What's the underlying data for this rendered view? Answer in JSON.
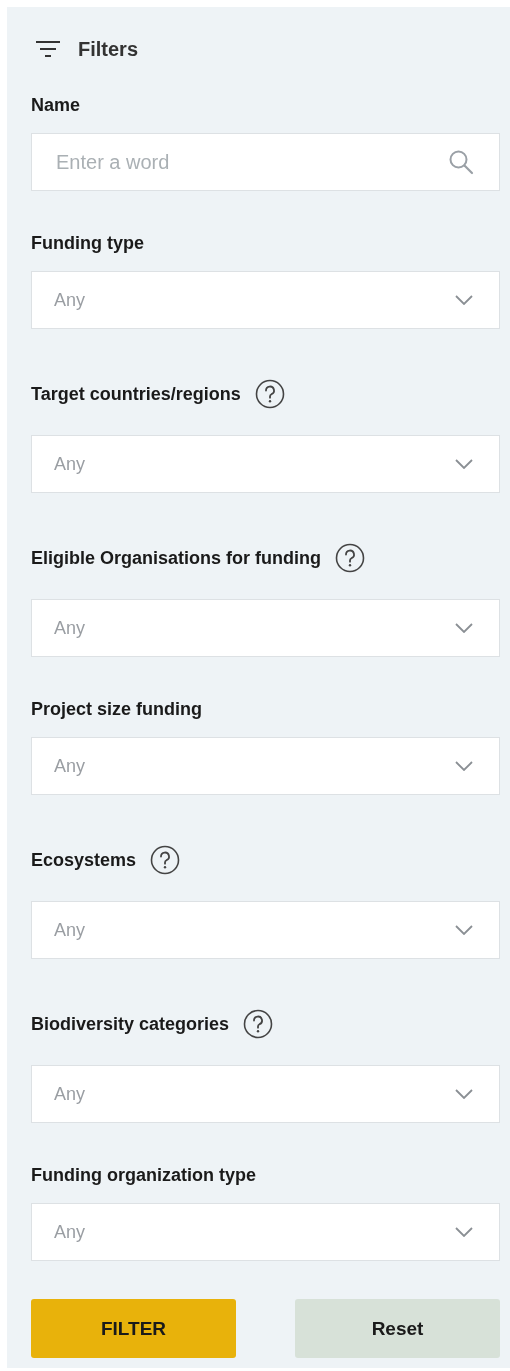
{
  "header": {
    "title": "Filters"
  },
  "fields": [
    {
      "kind": "search",
      "label": "Name",
      "help": false,
      "placeholder": "Enter a word"
    },
    {
      "kind": "select",
      "label": "Funding type",
      "help": false,
      "value": "Any"
    },
    {
      "kind": "select",
      "label": "Target countries/regions",
      "help": true,
      "value": "Any"
    },
    {
      "kind": "select",
      "label": "Eligible Organisations for funding",
      "help": true,
      "value": "Any"
    },
    {
      "kind": "select",
      "label": "Project size funding",
      "help": false,
      "value": "Any"
    },
    {
      "kind": "select",
      "label": "Ecosystems",
      "help": true,
      "value": "Any"
    },
    {
      "kind": "select",
      "label": "Biodiversity categories",
      "help": true,
      "value": "Any"
    },
    {
      "kind": "select",
      "label": "Funding organization type",
      "help": false,
      "value": "Any"
    }
  ],
  "buttons": [
    {
      "kind": "primary",
      "label": "FILTER"
    },
    {
      "kind": "secondary",
      "label": "Reset"
    }
  ]
}
